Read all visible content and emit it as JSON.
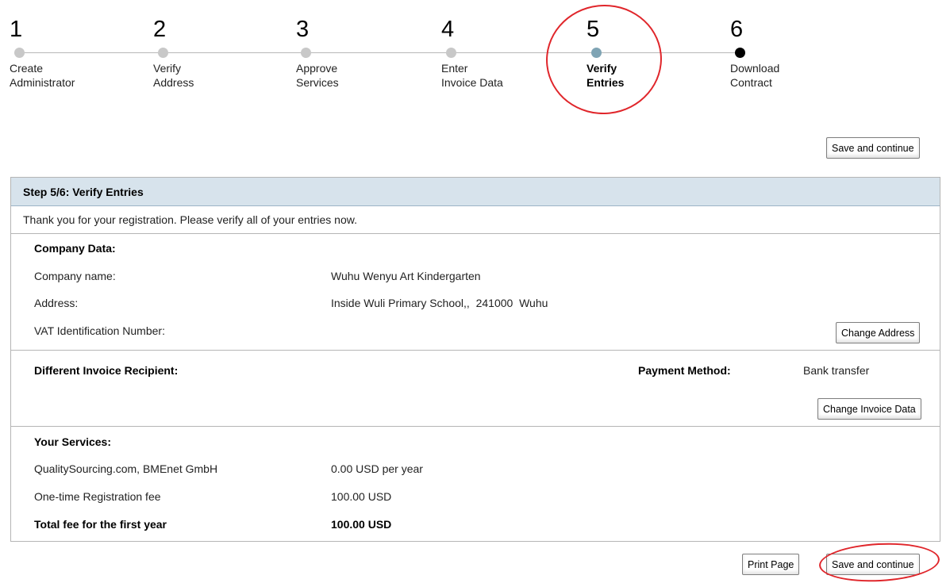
{
  "stepper": {
    "steps": [
      {
        "number": "1",
        "label": "Create\nAdministrator",
        "state": "done"
      },
      {
        "number": "2",
        "label": "Verify\nAddress",
        "state": "done"
      },
      {
        "number": "3",
        "label": "Approve\nServices",
        "state": "done"
      },
      {
        "number": "4",
        "label": "Enter\nInvoice Data",
        "state": "done"
      },
      {
        "number": "5",
        "label": "Verify\nEntries",
        "state": "current"
      },
      {
        "number": "6",
        "label": "Download\nContract",
        "state": "next"
      }
    ]
  },
  "toolbar": {
    "save_continue_top": "Save and continue"
  },
  "panel": {
    "title": "Step 5/6: Verify Entries",
    "intro": "Thank you for your registration. Please verify all of your entries now."
  },
  "company": {
    "heading": "Company Data:",
    "name_label": "Company name:",
    "name_value": "Wuhu Wenyu Art Kindergarten",
    "address_label": "Address:",
    "address_value": "Inside Wuli Primary School,,  241000  Wuhu",
    "vat_label": "VAT Identification Number:",
    "vat_value": "",
    "change_address_button": "Change Address"
  },
  "invoice": {
    "recipient_label": "Different Invoice Recipient:",
    "payment_method_label": "Payment Method:",
    "payment_method_value": "Bank transfer",
    "change_invoice_button": "Change Invoice Data"
  },
  "services": {
    "heading": "Your Services:",
    "rows": [
      {
        "name": "QualitySourcing.com, BMEnet GmbH",
        "value": "0.00 USD per year",
        "bold": false
      },
      {
        "name": "One-time Registration fee",
        "value": "100.00 USD",
        "bold": false
      },
      {
        "name": "Total fee for the first year",
        "value": "100.00 USD",
        "bold": true
      }
    ]
  },
  "footer": {
    "print_button": "Print Page",
    "save_continue_bottom": "Save and continue"
  },
  "colors": {
    "header_bg": "#d7e3ec",
    "active_dot": "#7fa4b4",
    "highlight_circle": "#e0262b"
  }
}
